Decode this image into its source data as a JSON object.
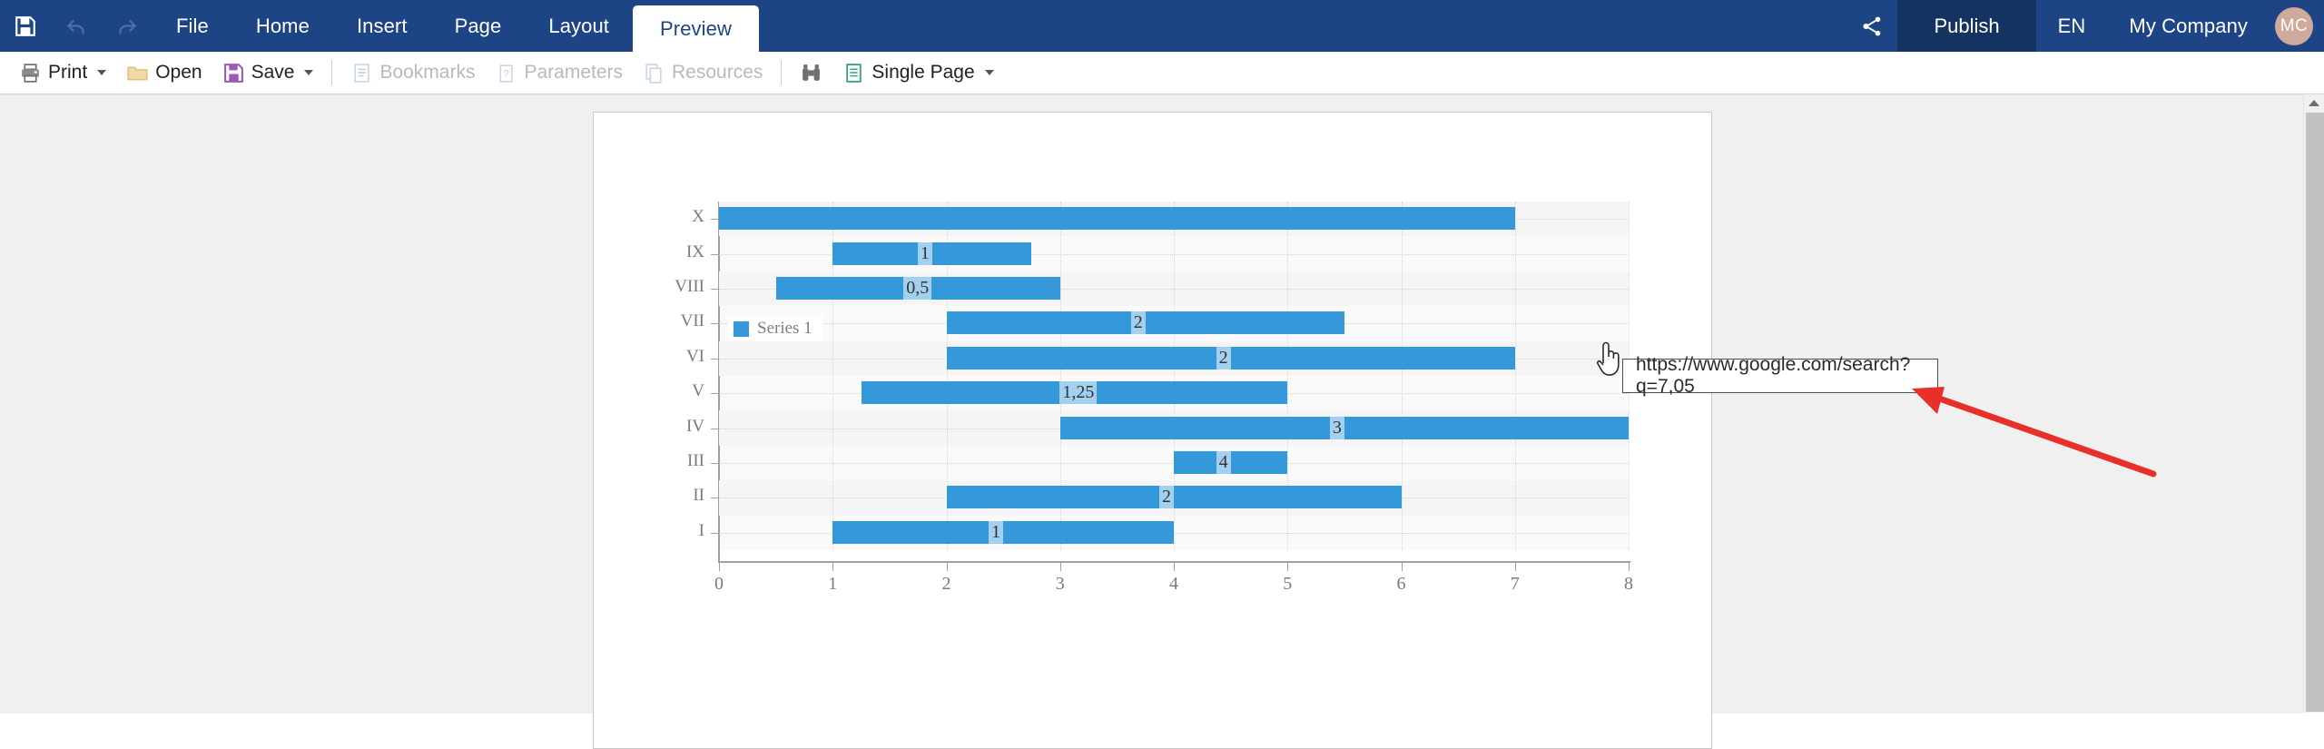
{
  "topnav": {
    "save_icon": "save-icon",
    "undo_icon": "undo-icon",
    "redo_icon": "redo-icon",
    "tabs": [
      {
        "label": "File",
        "active": false
      },
      {
        "label": "Home",
        "active": false
      },
      {
        "label": "Insert",
        "active": false
      },
      {
        "label": "Page",
        "active": false
      },
      {
        "label": "Layout",
        "active": false
      },
      {
        "label": "Preview",
        "active": true
      }
    ],
    "share_icon": "share-icon",
    "publish_label": "Publish",
    "language_label": "EN",
    "company_label": "My Company",
    "avatar_initials": "MC",
    "bg_color": "#1d4585",
    "publish_bg_color": "#143361",
    "avatar_color": "#cfa99c"
  },
  "toolbar": {
    "items": [
      {
        "label": "Print",
        "icon": "printer-icon",
        "caret": true,
        "disabled": false
      },
      {
        "label": "Open",
        "icon": "folder-icon",
        "caret": false,
        "disabled": false
      },
      {
        "label": "Save",
        "icon": "floppy-disk-icon",
        "caret": true,
        "disabled": false
      },
      {
        "label": "Bookmarks",
        "icon": "bookmarks-icon",
        "caret": false,
        "disabled": true
      },
      {
        "label": "Parameters",
        "icon": "parameters-icon",
        "caret": false,
        "disabled": true
      },
      {
        "label": "Resources",
        "icon": "resources-icon",
        "caret": false,
        "disabled": true
      },
      {
        "label": "Single Page",
        "icon": "page-view-icon",
        "caret": true,
        "disabled": false
      }
    ],
    "search_icon": "binoculars-icon"
  },
  "scrollbar": {
    "up_arrow_icon": "scroll-up-arrow-icon"
  },
  "tooltip": {
    "text": "https://www.google.com/search?q=7,05"
  },
  "annotation": {
    "arrow_color": "#e8302a",
    "name": "red-arrow-annotation"
  },
  "cursor": {
    "icon": "pointing-hand-cursor"
  },
  "chart_data": {
    "type": "bar",
    "orientation": "horizontal",
    "title": "",
    "xlabel": "",
    "ylabel": "",
    "xlim": [
      0,
      8
    ],
    "ylim_categories": [
      "I",
      "II",
      "III",
      "IV",
      "V",
      "VI",
      "VII",
      "VIII",
      "IX",
      "X"
    ],
    "xticks": [
      "0",
      "1",
      "2",
      "3",
      "4",
      "5",
      "6",
      "7",
      "8"
    ],
    "grid": true,
    "legend": {
      "position": "top-left",
      "entries": [
        "Series 1"
      ],
      "color": "#3498db"
    },
    "bar_color": "#3498db",
    "categories": [
      "X",
      "IX",
      "VIII",
      "VII",
      "VI",
      "V",
      "IV",
      "III",
      "II",
      "I"
    ],
    "bars": [
      {
        "category": "X",
        "start": 0,
        "end": 7,
        "label": ""
      },
      {
        "category": "IX",
        "start": 1,
        "end": 2.75,
        "label": "1"
      },
      {
        "category": "VIII",
        "start": 0.5,
        "end": 3,
        "label": "0,5"
      },
      {
        "category": "VII",
        "start": 2,
        "end": 5.5,
        "label": "2"
      },
      {
        "category": "VI",
        "start": 2,
        "end": 7,
        "label": "2"
      },
      {
        "category": "V",
        "start": 1.25,
        "end": 5,
        "label": "1,25"
      },
      {
        "category": "IV",
        "start": 3,
        "end": 8,
        "label": "3"
      },
      {
        "category": "III",
        "start": 4,
        "end": 5,
        "label": "4"
      },
      {
        "category": "II",
        "start": 2,
        "end": 6,
        "label": "2"
      },
      {
        "category": "I",
        "start": 1,
        "end": 4,
        "label": "1"
      }
    ]
  }
}
